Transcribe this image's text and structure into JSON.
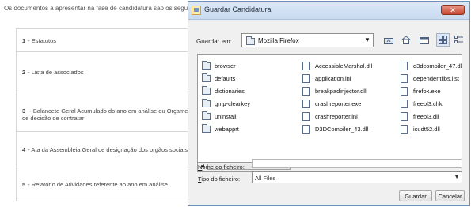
{
  "background_page": {
    "intro_text": "Os documentos a apresentar na fase de candidatura são os seguintes",
    "items": [
      {
        "number": "1",
        "label": "- Estatutos"
      },
      {
        "number": "2",
        "label": "- Lista de associados"
      },
      {
        "number": "3",
        "label": "- Balancete Geral Acumulado do ano em análise ou Orçamento",
        "label_line2": "de decisão de contratar"
      },
      {
        "number": "4",
        "label": "- Ata da Assembleia Geral de designação dos orgãos sociais"
      },
      {
        "number": "5",
        "label": "- Relatório de Atividades referente ao ano em análise"
      }
    ]
  },
  "dialog": {
    "title": "Guardar Candidatura",
    "close_glyph": "✕",
    "look_in_label": "Guardar em:",
    "look_in_value": "Mozilla Firefox",
    "toolbar_icons": [
      "up-one-level-icon",
      "home-icon",
      "new-folder-icon",
      "list-view-icon",
      "details-view-icon"
    ],
    "files": [
      {
        "name": "browser",
        "type": "folder"
      },
      {
        "name": "defaults",
        "type": "folder"
      },
      {
        "name": "dictionaries",
        "type": "folder"
      },
      {
        "name": "gmp-clearkey",
        "type": "folder"
      },
      {
        "name": "uninstall",
        "type": "folder"
      },
      {
        "name": "webapprt",
        "type": "folder"
      },
      {
        "name": "AccessibleMarshal.dll",
        "type": "file"
      },
      {
        "name": "application.ini",
        "type": "file"
      },
      {
        "name": "breakpadinjector.dll",
        "type": "file"
      },
      {
        "name": "crashreporter.exe",
        "type": "file"
      },
      {
        "name": "crashreporter.ini",
        "type": "file"
      },
      {
        "name": "D3DCompiler_43.dll",
        "type": "file"
      },
      {
        "name": "d3dcompiler_47.dll",
        "type": "file"
      },
      {
        "name": "dependentlibs.list",
        "type": "file"
      },
      {
        "name": "firefox.exe",
        "type": "file"
      },
      {
        "name": "freebl3.chk",
        "type": "file"
      },
      {
        "name": "freebl3.dll",
        "type": "file"
      },
      {
        "name": "icudt52.dll",
        "type": "file"
      }
    ],
    "file_name_label_u": "N",
    "file_name_label_rest": "ome do ficheiro:",
    "file_name_value": "",
    "file_type_label_u": "T",
    "file_type_label_rest": "ipo do ficheiro:",
    "file_type_value": "All Files",
    "save_button": "Guardar",
    "cancel_button": "Cancelar"
  }
}
